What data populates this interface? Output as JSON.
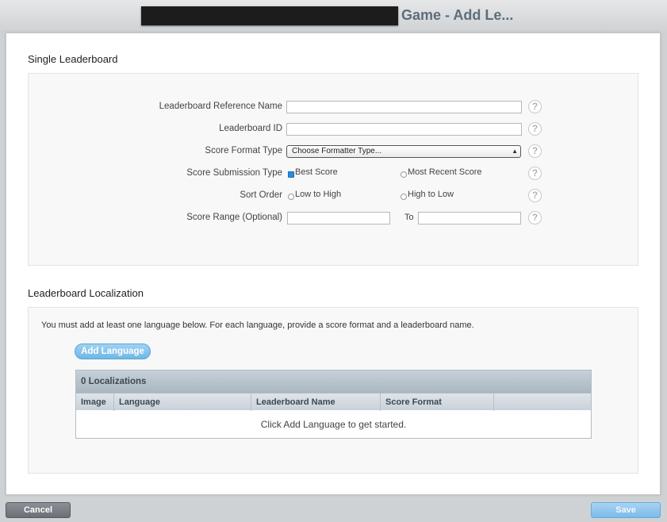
{
  "window": {
    "title": "Game - Add Le..."
  },
  "single": {
    "heading": "Single Leaderboard",
    "ref_name_label": "Leaderboard Reference Name",
    "id_label": "Leaderboard ID",
    "format_label": "Score Format Type",
    "format_value": "Choose Formatter Type...",
    "submission_label": "Score Submission Type",
    "submission_opt1": "Best Score",
    "submission_opt2": "Most Recent Score",
    "sort_label": "Sort Order",
    "sort_opt1": "Low to High",
    "sort_opt2": "High to Low",
    "range_label": "Score Range (Optional)",
    "range_to": "To",
    "help_glyph": "?"
  },
  "localization": {
    "heading": "Leaderboard Localization",
    "note": "You must add at least one language below. For each language, provide a score format and a leaderboard name.",
    "add_button": "Add Language",
    "count_label": "0 Localizations",
    "columns": [
      "Image",
      "Language",
      "Leaderboard Name",
      "Score Format"
    ],
    "empty_message": "Click Add Language to get started."
  },
  "footer": {
    "cancel": "Cancel",
    "save": "Save"
  }
}
